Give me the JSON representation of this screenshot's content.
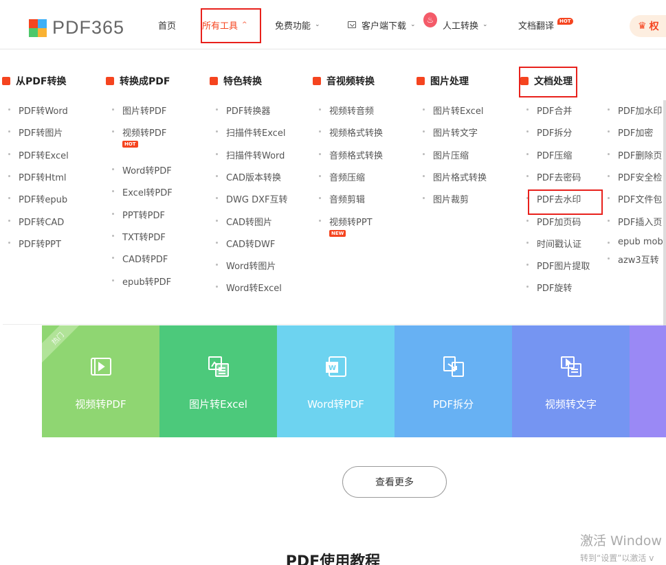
{
  "logo": {
    "text": "PDF365",
    "colors": [
      "#f5441f",
      "#3db0f7",
      "#4dc76a",
      "#f9b233"
    ]
  },
  "nav": {
    "items": [
      {
        "label": "首页",
        "has_chevron": false
      },
      {
        "label": "所有工具",
        "has_chevron": true,
        "active": true
      },
      {
        "label": "免费功能",
        "has_chevron": true
      },
      {
        "label": "客户端下载",
        "has_chevron": true
      },
      {
        "label": "人工转换",
        "has_chevron": true
      },
      {
        "label": "文档翻译",
        "has_chevron": false,
        "badge": "HOT"
      }
    ],
    "vip_label": "权"
  },
  "columns": [
    {
      "title": "从PDF转换",
      "icon_color": "#f5441f",
      "items": [
        "PDF转Word",
        "PDF转图片",
        "PDF转Excel",
        "PDF转Html",
        "PDF转epub",
        "PDF转CAD",
        "PDF转PPT"
      ]
    },
    {
      "title": "转换成PDF",
      "icon_color": "#f5441f",
      "items": [
        "图片转PDF",
        "视频转PDF",
        "Word转PDF",
        "Excel转PDF",
        "PPT转PDF",
        "TXT转PDF",
        "CAD转PDF",
        "epub转PDF"
      ],
      "tag": "HOT"
    },
    {
      "title": "特色转换",
      "icon_color": "#f5441f",
      "items": [
        "PDF转换器",
        "扫描件转Excel",
        "扫描件转Word",
        "CAD版本转换",
        "DWG DXF互转",
        "CAD转图片",
        "CAD转DWF",
        "Word转图片",
        "Word转Excel"
      ]
    },
    {
      "title": "音视频转换",
      "icon_color": "#f5441f",
      "items": [
        "视频转音频",
        "视频格式转换",
        "音频格式转换",
        "音频压缩",
        "音频剪辑",
        "视频转PPT"
      ],
      "tag": "NEW"
    },
    {
      "title": "图片处理",
      "icon_color": "#f5441f",
      "items": [
        "图片转Excel",
        "图片转文字",
        "图片压缩",
        "图片格式转换",
        "图片裁剪"
      ]
    },
    {
      "title": "文档处理",
      "icon_color": "#f5441f",
      "items": [
        "PDF合并",
        "PDF拆分",
        "PDF压缩",
        "PDF去密码",
        "PDF去水印",
        "PDF加页码",
        "时间戳认证",
        "PDF图片提取",
        "PDF旋转"
      ]
    },
    {
      "title": "",
      "icon_color": "",
      "items": [
        "PDF加水印",
        "PDF加密",
        "PDF删除页",
        "PDF安全检",
        "PDF文件包",
        "PDF插入页",
        "epub mob",
        "azw3互转"
      ]
    }
  ],
  "banner": [
    {
      "label": "视频转PDF",
      "color": "#8fd672",
      "ribbon": "热门"
    },
    {
      "label": "图片转Excel",
      "color": "#4cc97b"
    },
    {
      "label": "Word转PDF",
      "color": "#6dd3f0"
    },
    {
      "label": "PDF拆分",
      "color": "#67b1f3"
    },
    {
      "label": "视频转文字",
      "color": "#7595f2"
    },
    {
      "label": "",
      "color": "#9a89f5"
    }
  ],
  "more_label": "查看更多",
  "tutorial_title": "PDF使用教程",
  "watermark": {
    "line1": "激活 Window",
    "line2": "转到“设置”以激活 ⅴ"
  }
}
